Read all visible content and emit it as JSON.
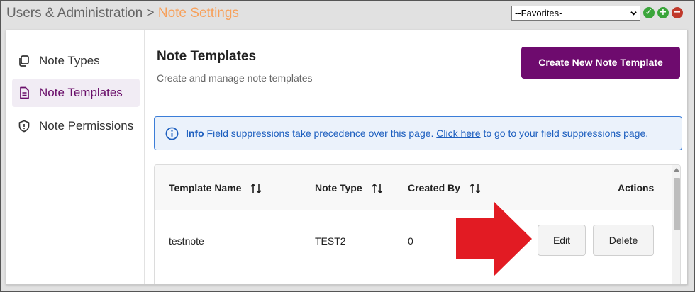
{
  "breadcrumb": {
    "parent": "Users & Administration",
    "separator": ">",
    "current": "Note Settings"
  },
  "favorites": {
    "selected": "--Favorites-"
  },
  "sidebar": {
    "items": [
      {
        "label": "Note Types",
        "icon": "copy-icon",
        "active": false
      },
      {
        "label": "Note Templates",
        "icon": "document-icon",
        "active": true
      },
      {
        "label": "Note Permissions",
        "icon": "shield-icon",
        "active": false
      }
    ]
  },
  "header": {
    "title": "Note Templates",
    "subtitle": "Create and manage note templates",
    "create_label": "Create New Note Template"
  },
  "info": {
    "label": "Info",
    "text_before": "Field suppressions take precedence over this page.",
    "link": "Click here",
    "text_after": "to go to your field suppressions page."
  },
  "table": {
    "columns": [
      "Template Name",
      "Note Type",
      "Created By",
      "Actions"
    ],
    "rows": [
      {
        "template_name": "testnote",
        "note_type": "TEST2",
        "created_by": "0"
      }
    ],
    "actions": {
      "edit": "Edit",
      "delete": "Delete"
    }
  },
  "colors": {
    "accent": "#6e0b6e",
    "current_crumb": "#f7a05a",
    "info_blue": "#1d5fbf",
    "annotation_arrow": "#e21b23"
  }
}
